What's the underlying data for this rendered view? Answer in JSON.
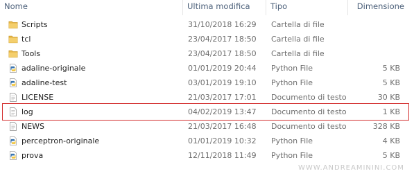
{
  "columns": {
    "name": "Nome",
    "date": "Ultima modifica",
    "type": "Tipo",
    "size": "Dimensione"
  },
  "files": [
    {
      "name": "Scripts",
      "date": "31/10/2018 16:29",
      "type": "Cartella di file",
      "size": "",
      "icon": "folder-icon"
    },
    {
      "name": "tcl",
      "date": "23/04/2017 18:50",
      "type": "Cartella di file",
      "size": "",
      "icon": "folder-icon"
    },
    {
      "name": "Tools",
      "date": "23/04/2017 18:50",
      "type": "Cartella di file",
      "size": "",
      "icon": "folder-icon"
    },
    {
      "name": "adaline-originale",
      "date": "01/01/2019 20:44",
      "type": "Python File",
      "size": "5 KB",
      "icon": "python-file-icon"
    },
    {
      "name": "adaline-test",
      "date": "03/01/2019 19:10",
      "type": "Python File",
      "size": "5 KB",
      "icon": "python-file-icon"
    },
    {
      "name": "LICENSE",
      "date": "21/03/2017 17:01",
      "type": "Documento di testo",
      "size": "30 KB",
      "icon": "text-file-icon"
    },
    {
      "name": "log",
      "date": "04/02/2019 13:47",
      "type": "Documento di testo",
      "size": "1 KB",
      "icon": "text-file-icon",
      "selected": true
    },
    {
      "name": "NEWS",
      "date": "21/03/2017 16:48",
      "type": "Documento di testo",
      "size": "328 KB",
      "icon": "text-file-icon"
    },
    {
      "name": "perceptron-originale",
      "date": "01/01/2019 10:32",
      "type": "Python File",
      "size": "4 KB",
      "icon": "python-file-icon"
    },
    {
      "name": "prova",
      "date": "12/11/2018 11:49",
      "type": "Python File",
      "size": "5 KB",
      "icon": "python-file-icon"
    }
  ],
  "watermark": "WWW.ANDREAMININI.COM",
  "colors": {
    "selection_border": "#d32f2f",
    "folder": "#e8b84a",
    "header_text": "#4c607a"
  }
}
